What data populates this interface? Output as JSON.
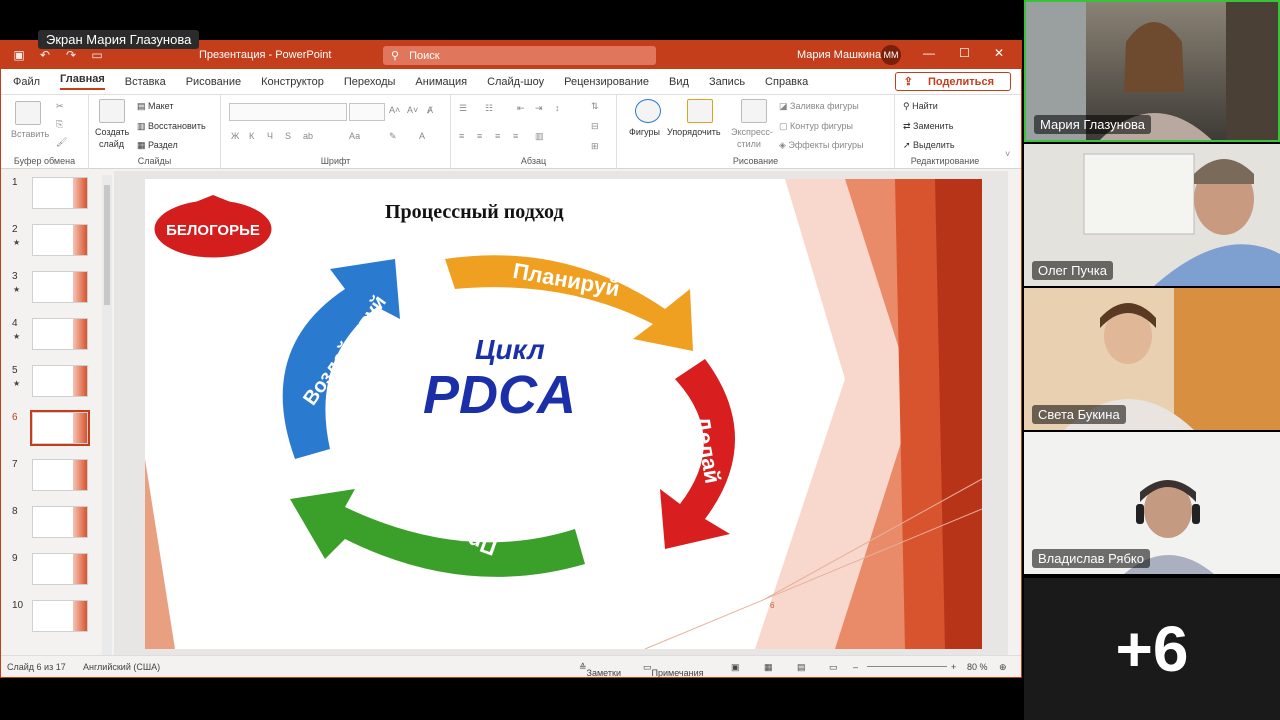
{
  "share_label": "Экран Мария Глазунова",
  "titlebar": {
    "title": "Презентация  -  PowerPoint",
    "search_placeholder": "Поиск",
    "user": "Мария Машкина",
    "avatar_initials": "ММ"
  },
  "menu": {
    "items": [
      "Файл",
      "Главная",
      "Вставка",
      "Рисование",
      "Конструктор",
      "Переходы",
      "Анимация",
      "Слайд-шоу",
      "Рецензирование",
      "Вид",
      "Запись",
      "Справка"
    ],
    "share": "Поделиться"
  },
  "ribbon": {
    "clipboard": {
      "paste": "Вставить",
      "label": "Буфер обмена"
    },
    "slides": {
      "create": "Создать",
      "slide": "слайд",
      "layout": "Макет",
      "restore": "Восстановить",
      "section": "Раздел",
      "label": "Слайды"
    },
    "font": {
      "label": "Шрифт",
      "buttons": [
        "Ж",
        "К",
        "Ч",
        "S",
        "ab",
        "Аа"
      ]
    },
    "paragraph": {
      "label": "Абзац"
    },
    "drawing": {
      "shapes": "Фигуры",
      "arrange": "Упорядочить",
      "express": "Экспресс-",
      "styles": "стили",
      "fill": "Заливка фигуры",
      "outline": "Контур фигуры",
      "effects": "Эффекты фигуры",
      "label": "Рисование"
    },
    "editing": {
      "find": "Найти",
      "replace": "Заменить",
      "select": "Выделить",
      "label": "Редактирование"
    }
  },
  "thumbnails": [
    {
      "num": "1",
      "star": false
    },
    {
      "num": "2",
      "star": true
    },
    {
      "num": "3",
      "star": true
    },
    {
      "num": "4",
      "star": true
    },
    {
      "num": "5",
      "star": true
    },
    {
      "num": "6",
      "star": false,
      "selected": true
    },
    {
      "num": "7",
      "star": false
    },
    {
      "num": "8",
      "star": false
    },
    {
      "num": "9",
      "star": false
    },
    {
      "num": "10",
      "star": false
    }
  ],
  "slide": {
    "title": "Процессный подход",
    "logo": "БЕЛОГОРЬЕ",
    "arrows": {
      "plan": "Планируй",
      "do": "Делай",
      "check": "Проверяй",
      "act": "Воздействуй"
    },
    "center_word": "Цикл",
    "center_acronym": "PDCA",
    "number": "6",
    "colors": {
      "plan": "#f0a020",
      "do": "#d81e1e",
      "check": "#3aa02a",
      "act": "#2a7ad0",
      "accent": "#c43e1c"
    }
  },
  "status": {
    "slide_info": "Слайд 6 из 17",
    "language": "Английский (США)",
    "notes": "Заметки",
    "comments": "Примечания",
    "zoom": "80 %"
  },
  "participants": [
    {
      "name": "Мария Глазунова",
      "active": true
    },
    {
      "name": "Олег Пучка"
    },
    {
      "name": "Света Букина"
    },
    {
      "name": "Владислав Рябко"
    }
  ],
  "more_count": "+6"
}
